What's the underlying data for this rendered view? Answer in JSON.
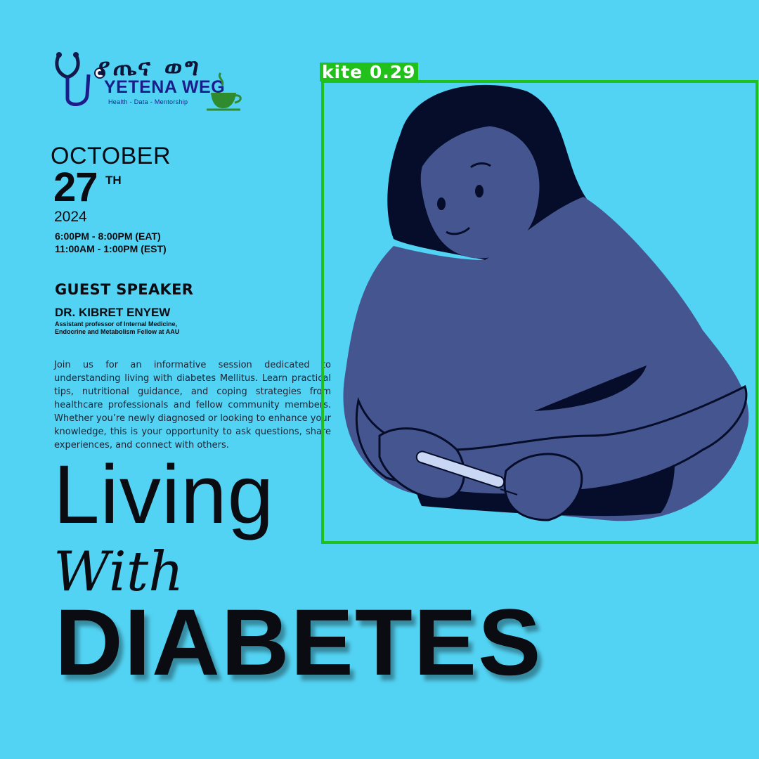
{
  "logo": {
    "amharic_text": "የጤና ወግ",
    "name": "YETENA WEG",
    "tagline": "Health - Data - Mentorship",
    "icon_names": [
      "stethoscope-icon",
      "tea-cup-icon"
    ]
  },
  "event": {
    "month": "OCTOBER",
    "day": "27",
    "day_suffix": "TH",
    "year": "2024",
    "time_eat": "6:00PM - 8:00PM (EAT)",
    "time_est": "11:00AM - 1:00PM (EST)"
  },
  "speaker": {
    "heading": "GUEST SPEAKER",
    "name": "DR. KIBRET ENYEW",
    "role_line1": "Assistant professor of Internal Medicine,",
    "role_line2": "Endocrine and Metabolism Fellow at AAU"
  },
  "description": "Join us for an informative session dedicated to understanding living with diabetes Mellitus. Learn practical tips, nutritional guidance, and coping strategies from healthcare professionals and fellow community members. Whether you’re newly diagnosed or looking to enhance your knowledge, this is your opportunity to ask questions, share experiences, and connect with others.",
  "headline": {
    "line1": "Living",
    "line2": "With",
    "line3": "DIABETES"
  },
  "detection": {
    "label": "kite",
    "score": "0.29",
    "color": "#22c01a"
  },
  "colors": {
    "background": "#53d3f3",
    "figure_body": "#45558f",
    "figure_hair": "#060d2a"
  }
}
